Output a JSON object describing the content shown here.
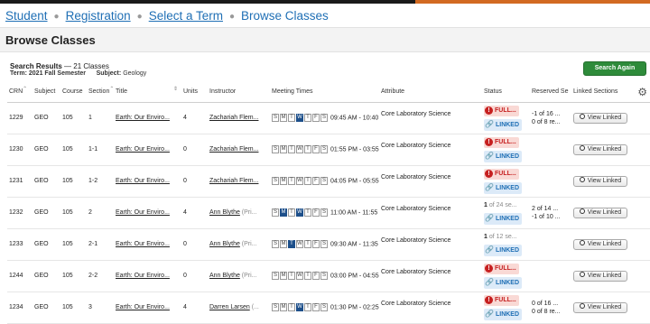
{
  "breadcrumb": [
    {
      "label": "Student",
      "link": true
    },
    {
      "label": "Registration",
      "link": true
    },
    {
      "label": "Select a Term",
      "link": true
    },
    {
      "label": "Browse Classes",
      "link": false
    }
  ],
  "page_title": "Browse Classes",
  "results": {
    "title": "Search Results",
    "count": "— 21 Classes",
    "term_label": "Term:",
    "term_value": "2021 Fall Semester",
    "subject_label": "Subject:",
    "subject_value": "Geology"
  },
  "search_again_label": "Search Again",
  "columns": [
    "CRN",
    "Subject",
    "Course",
    "Section",
    "Title",
    "Units",
    "Instructor",
    "Meeting Times",
    "Attribute",
    "Status",
    "Reserved Se",
    "Linked Sections"
  ],
  "day_letters": [
    "S",
    "M",
    "T",
    "W",
    "T",
    "F",
    "S"
  ],
  "view_linked_label": "View Linked",
  "rows": [
    {
      "crn": "1229",
      "subject": "GEO",
      "course": "105",
      "section": "1",
      "title": "Earth: Our Enviro...",
      "units": "4",
      "instructor": "Zachariah Flem...",
      "instr_extra": "",
      "days_on": [
        false,
        false,
        false,
        true,
        false,
        false,
        false
      ],
      "time": "09:45 AM - 10:40",
      "attribute": "Core Laboratory Science",
      "status_full": "FULL...",
      "status_seats": "",
      "status_seats_num": "",
      "linked": "LINKED",
      "reserved1": "-1 of 16 ...",
      "reserved2": "0 of 8 re..."
    },
    {
      "crn": "1230",
      "subject": "GEO",
      "course": "105",
      "section": "1-1",
      "title": "Earth: Our Enviro...",
      "units": "0",
      "instructor": "Zachariah Flem...",
      "instr_extra": "",
      "days_on": [
        false,
        false,
        false,
        false,
        false,
        false,
        false
      ],
      "time": "01:55 PM - 03:55",
      "attribute": "Core Laboratory Science",
      "status_full": "FULL...",
      "status_seats": "",
      "status_seats_num": "",
      "linked": "LINKED",
      "reserved1": "",
      "reserved2": ""
    },
    {
      "crn": "1231",
      "subject": "GEO",
      "course": "105",
      "section": "1-2",
      "title": "Earth: Our Enviro...",
      "units": "0",
      "instructor": "Zachariah Flem...",
      "instr_extra": "",
      "days_on": [
        false,
        false,
        false,
        false,
        false,
        false,
        false
      ],
      "time": "04:05 PM - 05:55",
      "attribute": "Core Laboratory Science",
      "status_full": "FULL...",
      "status_seats": "",
      "status_seats_num": "",
      "linked": "LINKED",
      "reserved1": "",
      "reserved2": ""
    },
    {
      "crn": "1232",
      "subject": "GEO",
      "course": "105",
      "section": "2",
      "title": "Earth: Our Enviro...",
      "units": "4",
      "instructor": "Ann Blythe",
      "instr_extra": " (Pri...",
      "days_on": [
        false,
        true,
        false,
        true,
        false,
        false,
        false
      ],
      "time": "11:00 AM - 11:55",
      "attribute": "Core Laboratory Science",
      "status_full": "",
      "status_seats": " of 24 se...",
      "status_seats_num": "1",
      "linked": "LINKED",
      "reserved1": "2 of 14 ...",
      "reserved2": "-1 of 10 ..."
    },
    {
      "crn": "1233",
      "subject": "GEO",
      "course": "105",
      "section": "2-1",
      "title": "Earth: Our Enviro...",
      "units": "0",
      "instructor": "Ann Blythe",
      "instr_extra": " (Pri...",
      "days_on": [
        false,
        false,
        true,
        false,
        false,
        false,
        false
      ],
      "time": "09:30 AM - 11:35",
      "attribute": "Core Laboratory Science",
      "status_full": "",
      "status_seats": " of 12 se...",
      "status_seats_num": "1",
      "linked": "LINKED",
      "reserved1": "",
      "reserved2": ""
    },
    {
      "crn": "1244",
      "subject": "GEO",
      "course": "105",
      "section": "2-2",
      "title": "Earth: Our Enviro...",
      "units": "0",
      "instructor": "Ann Blythe",
      "instr_extra": " (Pri...",
      "days_on": [
        false,
        false,
        false,
        false,
        false,
        false,
        false
      ],
      "time": "03:00 PM - 04:55",
      "attribute": "Core Laboratory Science",
      "status_full": "FULL...",
      "status_seats": "",
      "status_seats_num": "",
      "linked": "LINKED",
      "reserved1": "",
      "reserved2": ""
    },
    {
      "crn": "1234",
      "subject": "GEO",
      "course": "105",
      "section": "3",
      "title": "Earth: Our Enviro...",
      "units": "4",
      "instructor": "Darren Larsen",
      "instr_extra": " (...",
      "days_on": [
        false,
        false,
        false,
        true,
        false,
        false,
        false
      ],
      "time": "01:30 PM - 02:25",
      "attribute": "Core Laboratory Science",
      "status_full": "FULL...",
      "status_seats": "",
      "status_seats_num": "",
      "linked": "LINKED",
      "reserved1": "0 of 16 ...",
      "reserved2": "0 of 8 re..."
    }
  ]
}
